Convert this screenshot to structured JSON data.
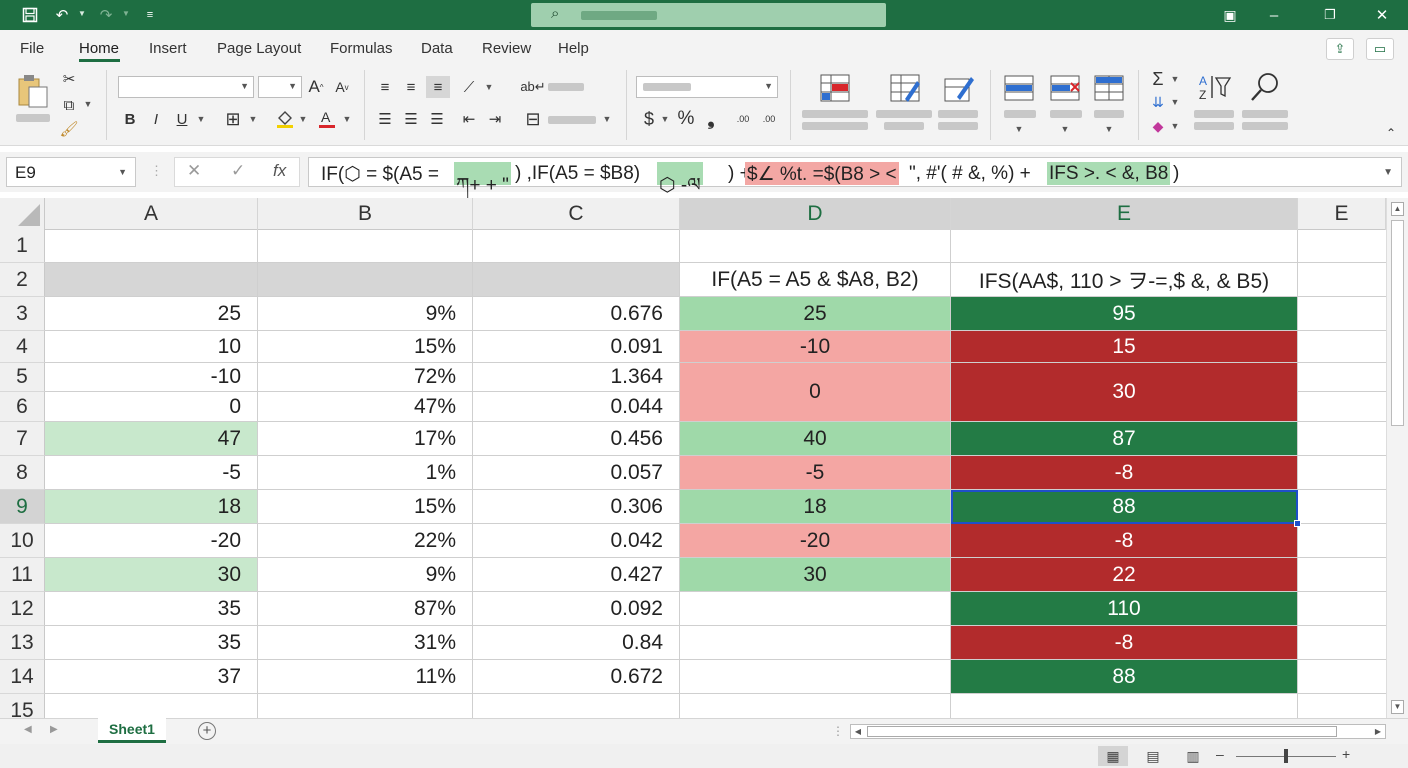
{
  "menu": {
    "tabs": [
      "File",
      "Home",
      "Insert",
      "Page Layout",
      "Formulas",
      "Data",
      "Review",
      "Help"
    ],
    "active": "Home"
  },
  "ribbon": {
    "bold": "B",
    "italic": "I",
    "underline": "U",
    "font_grow": "A",
    "font_shrink": "A",
    "currency": "$",
    "percent": "%",
    "comma": "❟",
    "inc_decimal": ".00",
    "dec_decimal": ".00"
  },
  "formula_bar": {
    "name_box": "E9",
    "cancel": "✕",
    "enter": "✓",
    "fx": "fx",
    "segments": [
      {
        "text": "IF(⬡ = $(A5 = ",
        "style": "plain"
      },
      {
        "text": "ཀ+ + \"",
        "style": "green"
      },
      {
        "text": ") ,IF(A5 = $B8)",
        "style": "plain"
      },
      {
        "text": "⬡ -ལ",
        "style": "green"
      },
      {
        "text": ") + ",
        "style": "plain"
      },
      {
        "text": "$∠ %t. =$(B8 > <",
        "style": "red"
      },
      {
        "text": "\", #'( # &, %) + ",
        "style": "plain"
      },
      {
        "text": "IFS >. < &, B8",
        "style": "green"
      },
      {
        "text": ")",
        "style": "plain"
      }
    ]
  },
  "grid": {
    "columns": [
      "A",
      "B",
      "C",
      "D",
      "E",
      "E"
    ],
    "selected_col": "E",
    "selected_row": 9,
    "active_cell": "E9",
    "rows": [
      {
        "n": "1",
        "a": "",
        "b": "",
        "c": "",
        "d": "",
        "e": ""
      },
      {
        "n": "2",
        "a": "",
        "b": "",
        "c": "",
        "d": "IF(A5 = A5 & $A8, B2)",
        "e": "IFS(AA$, 110 > ヲ-=,$ &, & B5)"
      },
      {
        "n": "3",
        "a": "25",
        "b": "9%",
        "c": "0.676",
        "d": "25",
        "e": "95"
      },
      {
        "n": "4",
        "a": "10",
        "b": "15%",
        "c": "0.091",
        "d": "-10",
        "e": "15"
      },
      {
        "n": "5",
        "a": "-10",
        "b": "72%",
        "c": "1.364",
        "d": "",
        "e": ""
      },
      {
        "n": "6",
        "a": "0",
        "b": "47%",
        "c": "0.044",
        "d": "0",
        "e": "30"
      },
      {
        "n": "7",
        "a": "47",
        "b": "17%",
        "c": "0.456",
        "d": "40",
        "e": "87"
      },
      {
        "n": "8",
        "a": "-5",
        "b": "1%",
        "c": "0.057",
        "d": "-5",
        "e": "-8"
      },
      {
        "n": "9",
        "a": "18",
        "b": "15%",
        "c": "0.306",
        "d": "18",
        "e": "88"
      },
      {
        "n": "10",
        "a": "-20",
        "b": "22%",
        "c": "0.042",
        "d": "-20",
        "e": "-8"
      },
      {
        "n": "11",
        "a": "30",
        "b": "9%",
        "c": "0.427",
        "d": "30",
        "e": "22"
      },
      {
        "n": "12",
        "a": "35",
        "b": "87%",
        "c": "0.092",
        "d": "",
        "e": "110"
      },
      {
        "n": "13",
        "a": "35",
        "b": "31%",
        "c": "0.84",
        "d": "",
        "e": "-8"
      },
      {
        "n": "14",
        "a": "37",
        "b": "11%",
        "c": "0.672",
        "d": "",
        "e": "88"
      },
      {
        "n": "15",
        "a": "",
        "b": "",
        "c": "",
        "d": "",
        "e": ""
      }
    ]
  },
  "sheets": {
    "tabs": [
      "Sheet1"
    ],
    "add": "+"
  },
  "status": {
    "zoom_fraction": 0.5
  },
  "colors": {
    "brand": "#1e6e42",
    "light_green": "#c8e8cc",
    "medium_green": "#9fd9a9",
    "dark_green": "#237b45",
    "light_red": "#f4a6a3",
    "dark_red": "#b22b2c",
    "selection": "#1f4fc9"
  }
}
